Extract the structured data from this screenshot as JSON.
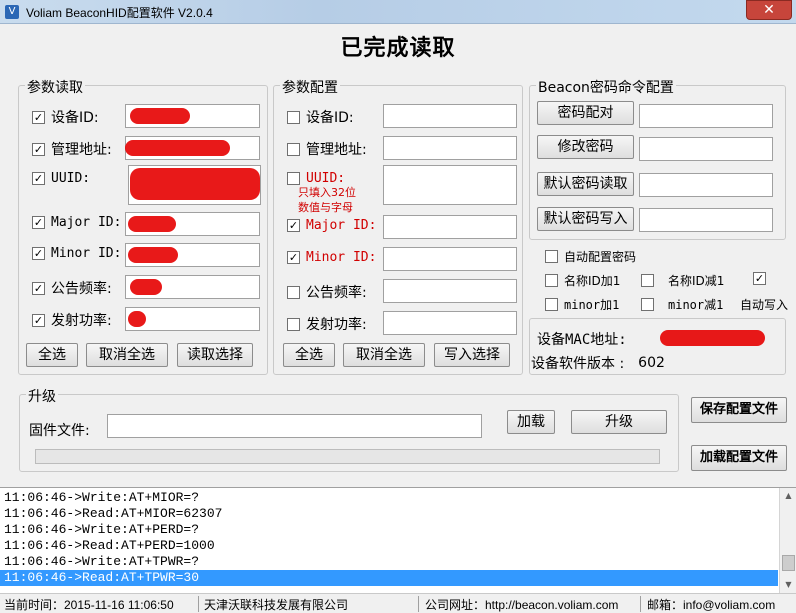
{
  "window": {
    "title": "Voliam BeaconHID配置软件 V2.0.4",
    "close_label": "✕"
  },
  "status_title": "已完成读取",
  "read_group": {
    "legend": "参数读取",
    "rows": [
      {
        "label": "设备ID:",
        "checked": "✓"
      },
      {
        "label": "管理地址:",
        "checked": "✓"
      },
      {
        "label": "UUID:",
        "checked": "✓"
      },
      {
        "label": "Major ID:",
        "checked": "✓"
      },
      {
        "label": "Minor ID:",
        "checked": "✓"
      },
      {
        "label": "公告频率:",
        "checked": "✓"
      },
      {
        "label": "发射功率:",
        "checked": "✓"
      }
    ],
    "buttons": {
      "select_all": "全选",
      "cancel_all": "取消全选",
      "read_selected": "读取选择"
    }
  },
  "config_group": {
    "legend": "参数配置",
    "rows": [
      {
        "label": "设备ID:",
        "checked": ""
      },
      {
        "label": "管理地址:",
        "checked": ""
      },
      {
        "label": "UUID:",
        "checked": ""
      },
      {
        "label": "Major ID:",
        "checked": "✓"
      },
      {
        "label": "Minor ID:",
        "checked": "✓"
      },
      {
        "label": "公告频率:",
        "checked": ""
      },
      {
        "label": "发射功率:",
        "checked": ""
      }
    ],
    "uuid_hint_1": "只填入32位",
    "uuid_hint_2": "数值与字母",
    "buttons": {
      "select_all": "全选",
      "cancel_all": "取消全选",
      "write_selected": "写入选择"
    }
  },
  "beacon_group": {
    "legend": "Beacon密码命令配置",
    "buttons": [
      "密码配对",
      "修改密码",
      "默认密码读取",
      "默认密码写入"
    ]
  },
  "options": {
    "auto_password": "自动配置密码",
    "name_id_inc": "名称ID加1",
    "name_id_dec": "名称ID减1",
    "third_check": "✓",
    "minor_inc": "minor加1",
    "minor_dec": "minor减1",
    "auto_write": "自动写入"
  },
  "device_info": {
    "mac_label": "设备MAC地址:",
    "version_label": "设备软件版本 :",
    "version_value": "602"
  },
  "upgrade": {
    "legend": "升级",
    "firmware_label": "固件文件:",
    "load_button": "加载",
    "upgrade_button": "升级"
  },
  "side_buttons": {
    "save": "保存配置文件",
    "load": "加载配置文件"
  },
  "log_lines": [
    "11:06:46->Write:AT+MIOR=?",
    "11:06:46->Read:AT+MIOR=62307",
    "11:06:46->Write:AT+PERD=?",
    "11:06:46->Read:AT+PERD=1000",
    "11:06:46->Write:AT+TPWR=?",
    "11:06:46->Read:AT+TPWR=30"
  ],
  "status_bar": {
    "time": "当前时间：2015-11-16 11:06:50",
    "company": "天津沃联科技发展有限公司",
    "website": "公司网址：http://beacon.voliam.com",
    "email": "邮箱：info@voliam.com"
  }
}
